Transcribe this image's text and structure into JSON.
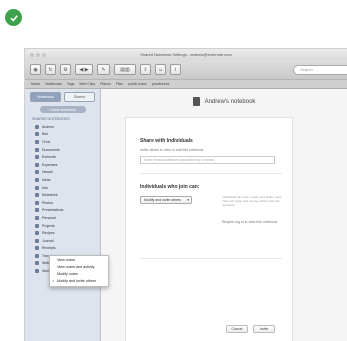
{
  "window": {
    "title": "Shared Notebook Settings - andrew@evernote.com"
  },
  "toolbar": {
    "search_placeholder": "Search"
  },
  "tabs": [
    "Notes",
    "Notebooks",
    "Tags",
    "Web Clips",
    "Places",
    "Files",
    "public notes",
    "procedures"
  ],
  "sidebar": {
    "segments": [
      "Notebooks",
      "Shared"
    ],
    "create_label": "Create Notebook",
    "section_header": "SHARED NOTEBOOKS",
    "items": [
      "Andrew",
      "Ben",
      "Chris",
      "Documents",
      "Evernote",
      "Expenses",
      "Hawaii",
      "Ideas",
      "Info",
      "Moleskine",
      "Photos",
      "Presentations",
      "Personal",
      "Projects",
      "Recipes",
      "Journal",
      "Receipts",
      "Travel",
      "Web",
      "Work"
    ]
  },
  "notebook": {
    "title": "Andrew's notebook"
  },
  "dialog": {
    "share_heading": "Share with Individuals",
    "share_desc": "Invite others to view or edit this notebook",
    "email_placeholder": "Enter email addresses separated by commas",
    "joined_heading": "Individuals who join can:",
    "permission_selected": "Modify and invite others",
    "side_note": "Individuals can view, modify and share notes. They can invite and remove others from the notebook.",
    "require_login": "Require log in to view this notebook",
    "menu_items": [
      "View notes",
      "View notes and activity",
      "Modify notes",
      "Modify and invite others"
    ],
    "checked_index": 3,
    "cancel_label": "Cancel",
    "invite_label": "Invite"
  },
  "colors": {
    "check_badge": "#3da24b",
    "sidebar_bg": "#dde4ee"
  }
}
